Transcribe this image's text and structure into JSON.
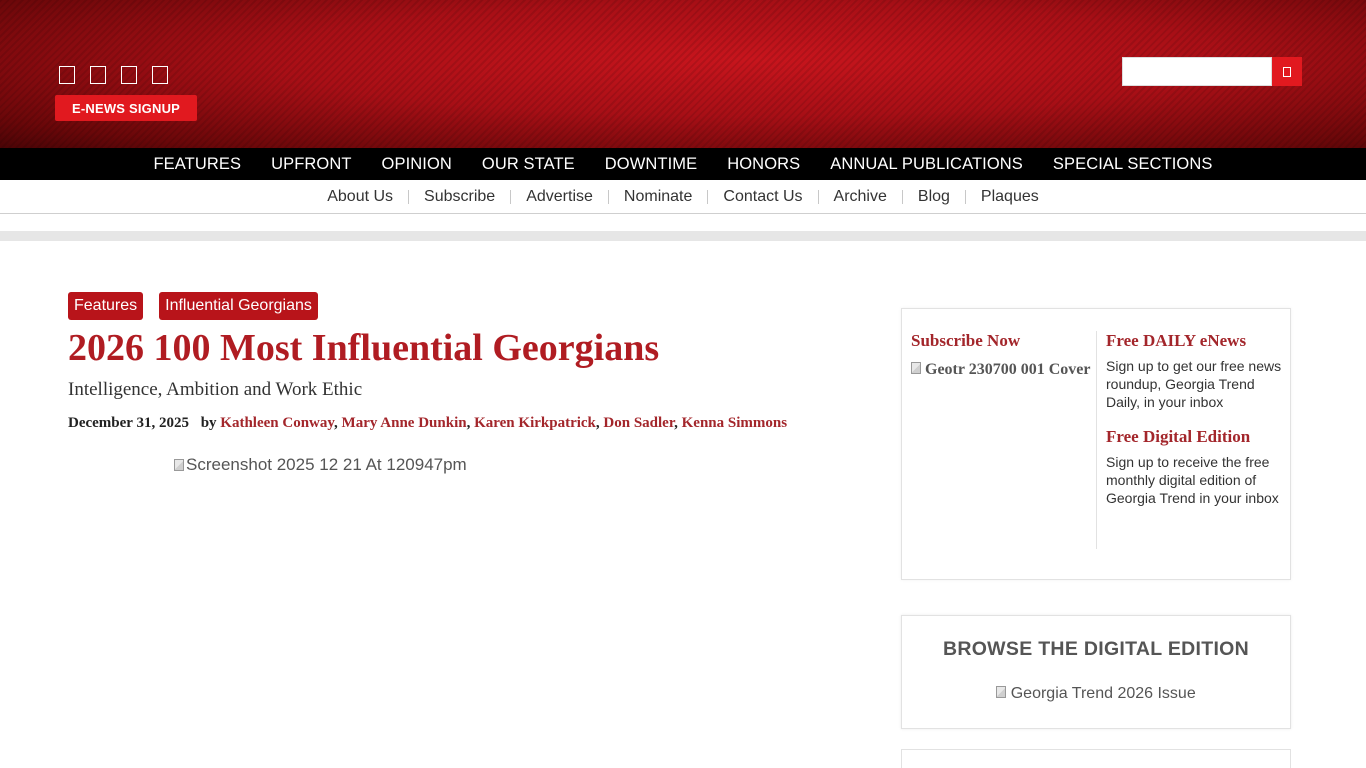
{
  "header": {
    "social_icons": [
      "facebook-icon",
      "twitter-icon",
      "instagram-icon",
      "linkedin-icon"
    ],
    "enews_label": "E-NEWS SIGNUP",
    "search_value": "",
    "search_icon": "search-icon"
  },
  "primary_nav": [
    "FEATURES",
    "UPFRONT",
    "OPINION",
    "OUR STATE",
    "DOWNTIME",
    "HONORS",
    "ANNUAL PUBLICATIONS",
    "SPECIAL SECTIONS"
  ],
  "secondary_nav": [
    "About Us",
    "Subscribe",
    "Advertise",
    "Nominate",
    "Contact Us",
    "Archive",
    "Blog",
    "Plaques"
  ],
  "article": {
    "categories": [
      "Features",
      "Influential Georgians"
    ],
    "title": "2026 100 Most Influential Georgians",
    "subtitle": "Intelligence, Ambition and Work Ethic",
    "date": "December 31, 2025",
    "by": "by",
    "authors": [
      "Kathleen Conway",
      "Mary Anne Dunkin",
      "Karen Kirkpatrick",
      "Don Sadler",
      "Kenna Simmons"
    ],
    "hero_alt": "Screenshot 2025 12 21 At 120947pm"
  },
  "sidebar": {
    "subscribe_heading": "Subscribe Now",
    "cover_alt": "Geotr 230700 001 Cover",
    "daily_heading": "Free DAILY eNews",
    "daily_desc": "Sign up to get our free news roundup, Georgia Trend Daily, in your inbox",
    "digital_heading": "Free Digital Edition",
    "digital_desc": "Sign up to receive the free monthly digital edition of Georgia Trend in your inbox",
    "browse_title": "BROWSE THE DIGITAL EDITION",
    "browse_alt": "Georgia Trend 2026 Issue"
  },
  "colors": {
    "brand_red": "#b01c22",
    "button_red": "#e1191f",
    "nav_black": "#000000"
  }
}
